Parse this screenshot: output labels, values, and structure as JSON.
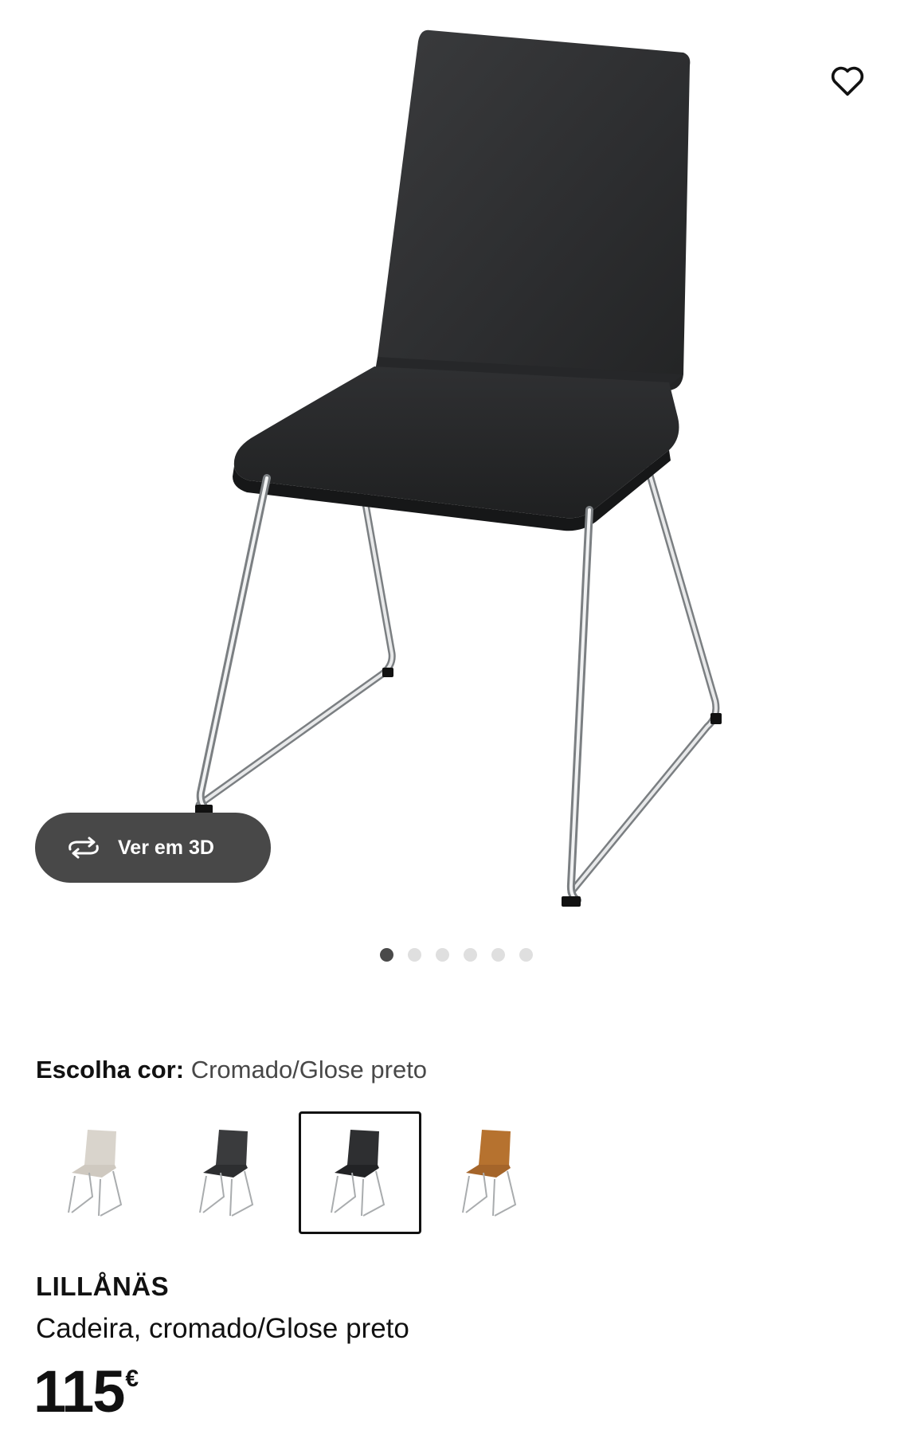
{
  "gallery": {
    "view3d_label": "Ver em 3D",
    "image_count": 6,
    "active_index": 0
  },
  "colors": {
    "label": "Escolha cor:",
    "selected": "Cromado/Glose preto",
    "options": [
      {
        "seat": "#d9d4cc",
        "selected": false
      },
      {
        "seat": "#3a3b3d",
        "selected": false
      },
      {
        "seat": "#2e2f31",
        "selected": true
      },
      {
        "seat": "#b6722f",
        "selected": false
      }
    ]
  },
  "product": {
    "name": "LILLÅNÄS",
    "description": "Cadeira, cromado/Glose preto",
    "price": "115",
    "currency": "€"
  }
}
